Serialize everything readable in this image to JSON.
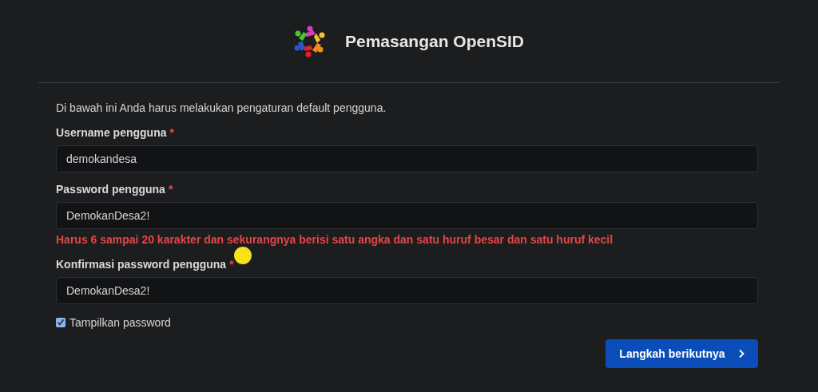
{
  "header": {
    "title": "Pemasangan OpenSID"
  },
  "intro": "Di bawah ini Anda harus melakukan pengaturan default pengguna.",
  "fields": [
    {
      "label": "Username pengguna",
      "required_mark": "*",
      "value": "demokandesa"
    },
    {
      "label": "Password pengguna",
      "required_mark": "*",
      "value": "DemokanDesa2!",
      "error": "Harus 6 sampai 20 karakter dan sekurangnya berisi satu angka dan satu huruf besar dan satu huruf kecil"
    },
    {
      "label": "Konfirmasi password pengguna",
      "required_mark": "*",
      "value": "DemokanDesa2!"
    }
  ],
  "show_password": {
    "label": "Tampilkan password",
    "checked": true
  },
  "next_button": {
    "label": "Langkah berikutnya"
  }
}
